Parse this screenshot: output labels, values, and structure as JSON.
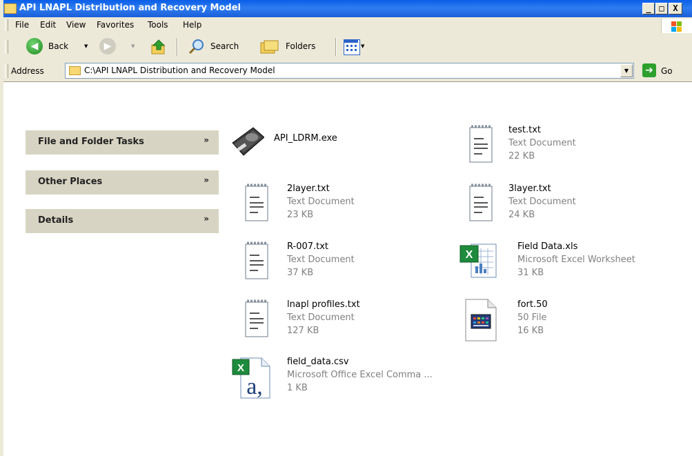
{
  "window": {
    "title": "API LNAPL Distribution and Recovery Model",
    "min_label": "_",
    "max_label": "□",
    "close_label": "X"
  },
  "menu": {
    "items": [
      "File",
      "Edit",
      "View",
      "Favorites",
      "Tools",
      "Help"
    ]
  },
  "toolbar": {
    "back_label": "Back",
    "search_label": "Search",
    "folders_label": "Folders"
  },
  "address": {
    "label": "Address",
    "value": "C:\\API LNAPL Distribution and Recovery Model",
    "go_label": "Go"
  },
  "side_panels": [
    {
      "title": "File and Folder Tasks",
      "chevron": "»"
    },
    {
      "title": "Other Places",
      "chevron": "»"
    },
    {
      "title": "Details",
      "chevron": "»"
    }
  ],
  "files": [
    {
      "name": "API_LDRM.exe",
      "type": "",
      "size": "",
      "icon": "application-icon"
    },
    {
      "name": "test.txt",
      "type": "Text Document",
      "size": "22 KB",
      "icon": "text-document-icon"
    },
    {
      "name": "2layer.txt",
      "type": "Text Document",
      "size": "23 KB",
      "icon": "text-document-icon"
    },
    {
      "name": "3layer.txt",
      "type": "Text Document",
      "size": "24 KB",
      "icon": "text-document-icon"
    },
    {
      "name": "R-007.txt",
      "type": "Text Document",
      "size": "37 KB",
      "icon": "text-document-icon"
    },
    {
      "name": "Field Data.xls",
      "type": "Microsoft Excel Worksheet",
      "size": "31 KB",
      "icon": "excel-worksheet-icon"
    },
    {
      "name": "lnapl profiles.txt",
      "type": "Text Document",
      "size": "127 KB",
      "icon": "text-document-icon"
    },
    {
      "name": "fort.50",
      "type": "50 File",
      "size": "16 KB",
      "icon": "generic-file-icon"
    },
    {
      "name": "field_data.csv",
      "type": "Microsoft Office Excel Comma ...",
      "size": "1 KB",
      "icon": "excel-csv-icon"
    }
  ],
  "colors": {
    "titlebar": "#0a5ee8",
    "chrome": "#ece9d8",
    "panel": "#d8d4c3",
    "secondary_text": "#808080"
  }
}
